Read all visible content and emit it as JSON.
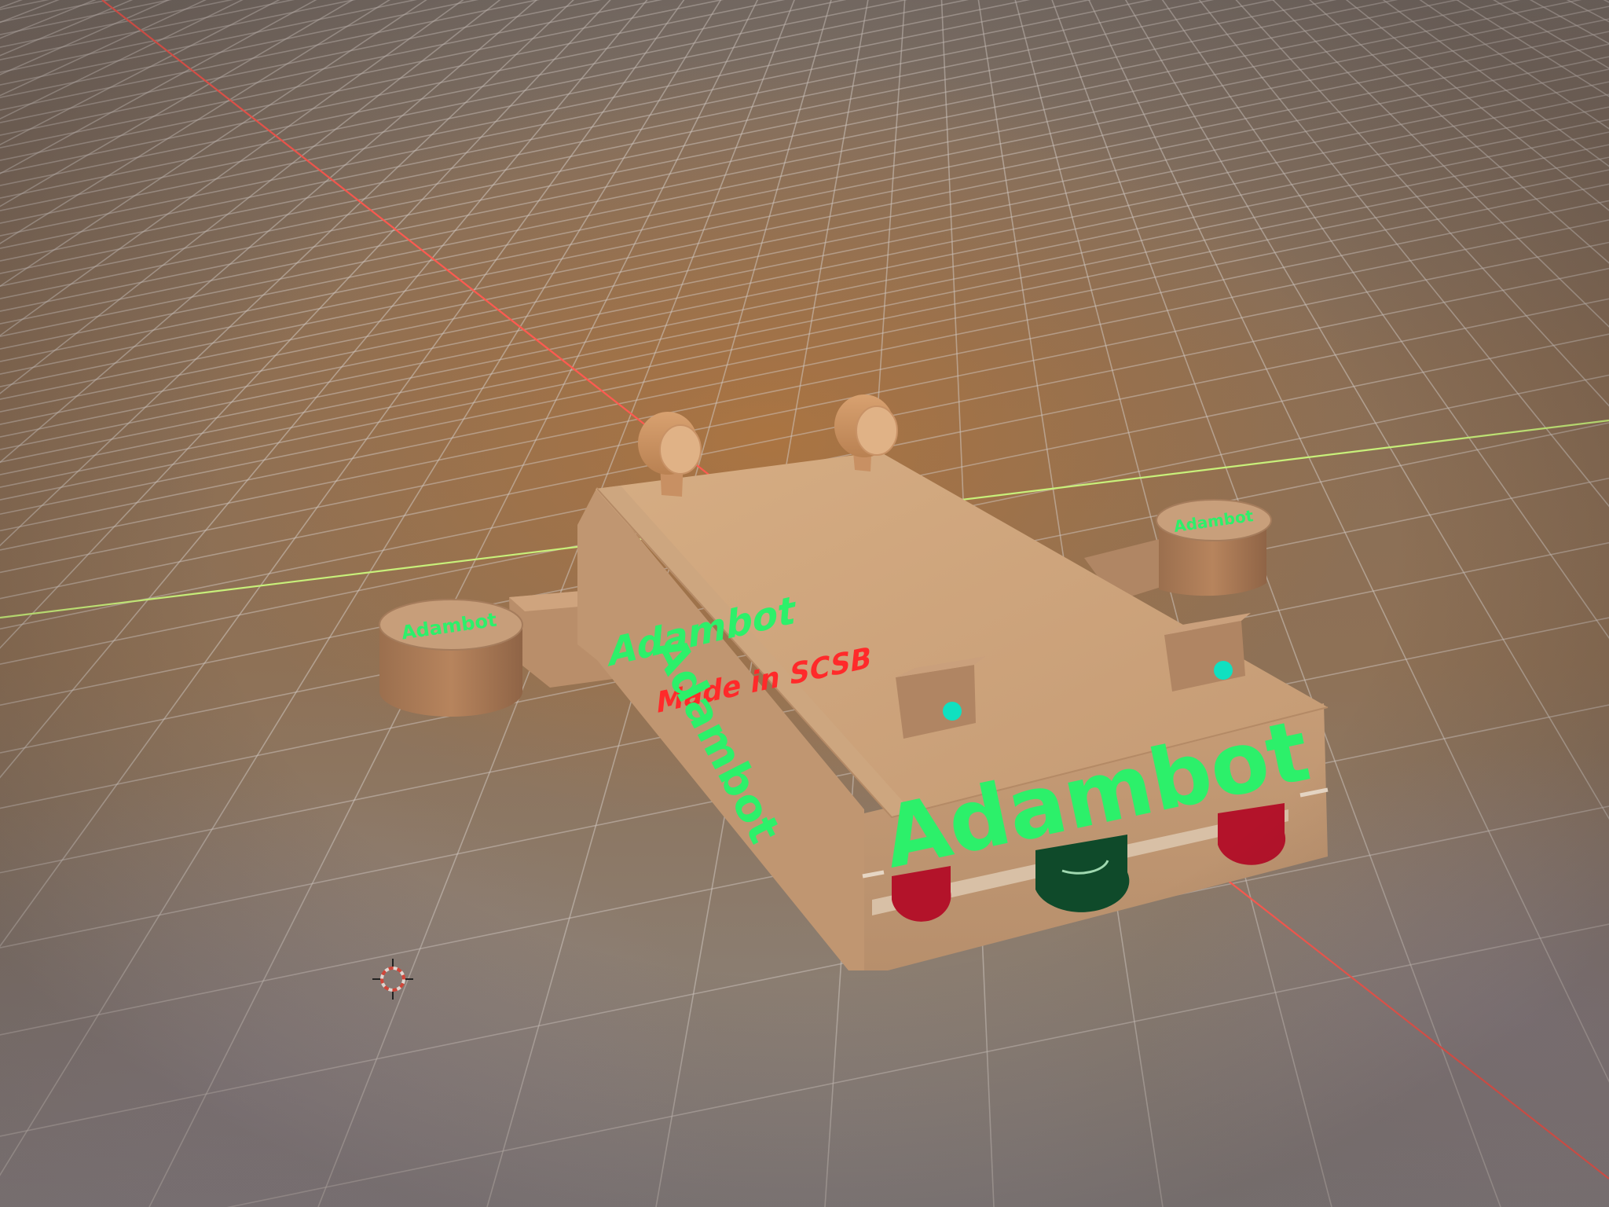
{
  "viewport": {
    "mode": "3d-perspective",
    "colors": {
      "grid_line": "#cfc6c0",
      "x_axis": "#ff5a50",
      "y_axis": "#c8f07a",
      "model_body": "#c9a07a",
      "text_green": "#2cf06a",
      "text_red": "#ff2a2a",
      "led_cyan": "#10e0c0",
      "tail_light": "#b3132a",
      "center_light": "#0f4a2a"
    }
  },
  "model": {
    "name": "Adambot",
    "top_label": "Adambot",
    "sub_label": "Made in SCSB",
    "side_label": "Adambot",
    "front_label": "Adambot",
    "left_wheel_label": "Adambot",
    "right_wheel_label": "Adambot"
  },
  "cursor": {
    "icon": "3d-cursor-icon"
  }
}
